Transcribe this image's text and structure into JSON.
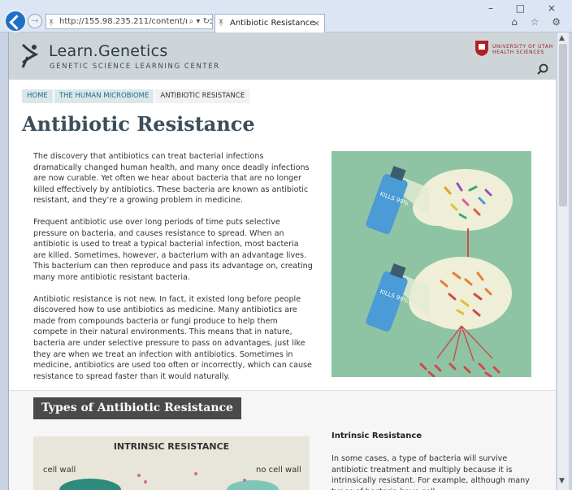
{
  "browser": {
    "url": "http://155.98.235.211/content/microbior",
    "tab_title": "Antibiotic Resistance",
    "address_icons": "⌕ ▾ ↻",
    "tab_close": "×",
    "window_controls": "– □ ×",
    "toolbar_icons": "⌂ ☆ ⚙"
  },
  "site": {
    "name": "Learn.Genetics",
    "subtitle": "GENETIC SCIENCE LEARNING CENTER",
    "partner_line1": "UNIVERSITY OF UTAH",
    "partner_line2": "HEALTH SCIENCES"
  },
  "breadcrumb": [
    "HOME",
    "THE HUMAN MICROBIOME",
    "ANTIBIOTIC RESISTANCE"
  ],
  "page": {
    "title": "Antibiotic Resistance",
    "paragraphs": [
      "The discovery that antibiotics can treat bacterial infections dramatically changed human health, and many once deadly infections are now curable. Yet often we hear about bacteria that are no longer killed effectively by antibiotics. These bacteria are known as antibiotic resistant, and they’re a growing problem in medicine.",
      "Frequent antibiotic use over long periods of time puts selective pressure on bacteria, and causes resistance to spread. When an antibiotic is used to treat a typical bacterial infection, most bacteria are killed. Sometimes, however, a bacterium with an advantage lives. This bacterium can then reproduce and pass its advantage on, creating many more antibiotic resistant bacteria.",
      "Antibiotic resistance is not new. In fact, it existed long before people discovered how to use antibiotics as medicine. Many antibiotics are made from compounds bacteria or fungi produce to help them compete in their natural environments. This means that in nature, bacteria are under selective pressure to pass on advantages, just like they are when we treat an infection with antibiotics. Sometimes in medicine, antibiotics are used too often or incorrectly, which can cause resistance to spread faster than it would naturally."
    ],
    "spray_label_1": "KILLS 99%",
    "spray_label_2": "KILLS 99%"
  },
  "section": {
    "title": "Types of Antibiotic Resistance",
    "diagram_title": "INTRINSIC RESISTANCE",
    "label_cell_wall": "cell wall",
    "label_no_cell_wall": "no cell wall",
    "intrinsic_heading": "Intrinsic Resistance",
    "intrinsic_text": "In some cases, a type of bacteria will survive antibiotic treatment and multiply because it is intrinsically resistant. For example, although many types of bacteria have cell"
  }
}
